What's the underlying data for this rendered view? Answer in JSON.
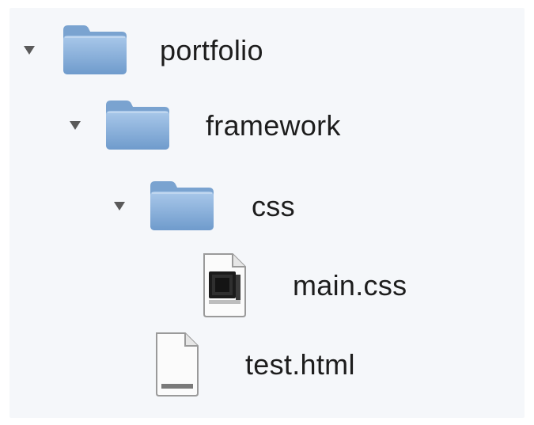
{
  "tree": {
    "items": [
      {
        "label": "portfolio",
        "icon": "folder-icon",
        "expanded": true
      },
      {
        "label": "framework",
        "icon": "folder-icon",
        "expanded": true
      },
      {
        "label": "css",
        "icon": "folder-icon",
        "expanded": true
      },
      {
        "label": "main.css",
        "icon": "css-file-icon"
      },
      {
        "label": "test.html",
        "icon": "html-file-icon"
      }
    ]
  },
  "colors": {
    "background": "#f5f7fa",
    "folder_body": "#8db4df",
    "folder_tab": "#7aa3d0",
    "text": "#1d1d1d",
    "disclosure": "#5a5a5a"
  }
}
